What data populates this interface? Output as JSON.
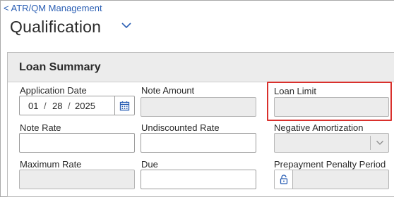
{
  "nav": {
    "back_label": "< ATR/QM Management"
  },
  "page": {
    "title": "Qualification"
  },
  "section": {
    "title": "Loan Summary"
  },
  "fields": {
    "application_date": {
      "label": "Application Date",
      "month": "01",
      "day": "28",
      "year": "2025",
      "sep": "/"
    },
    "note_amount": {
      "label": "Note Amount",
      "value": ""
    },
    "loan_limit": {
      "label": "Loan Limit",
      "value": ""
    },
    "note_rate": {
      "label": "Note Rate",
      "value": ""
    },
    "undiscounted_rate": {
      "label": "Undiscounted Rate",
      "value": ""
    },
    "negative_amortization": {
      "label": "Negative Amortization",
      "selected": ""
    },
    "maximum_rate": {
      "label": "Maximum Rate",
      "value": ""
    },
    "due": {
      "label": "Due",
      "value": ""
    },
    "prepayment_penalty_period": {
      "label": "Prepayment Penalty Period",
      "value": ""
    }
  },
  "icons": {
    "title_dropdown": "chevron-down-icon",
    "calendar": "calendar-icon",
    "select_caret": "chevron-down-icon",
    "lock": "lock-icon"
  },
  "colors": {
    "link": "#2b5fb4",
    "highlight": "#d9302c",
    "disabled_fill": "#ececec",
    "header_fill": "#ececec"
  }
}
